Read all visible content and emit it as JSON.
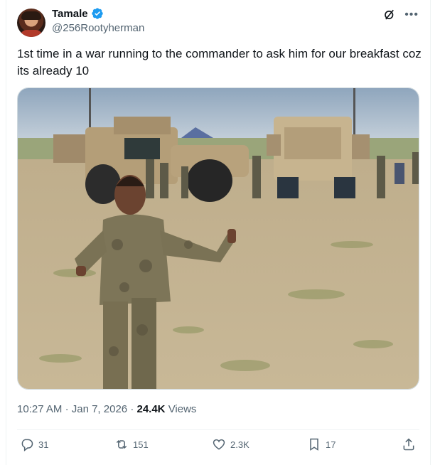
{
  "author": {
    "name": "Tamale",
    "handle": "@256Rootyherman",
    "verified_color": "#1d9bf0"
  },
  "tweet": {
    "text": "1st time in a war running to the commander to ask him for our breakfast coz its already 10"
  },
  "meta": {
    "time": "10:27 AM",
    "sep1": "·",
    "date": "Jan 7, 2026",
    "sep2": "·",
    "views_count": "24.4K",
    "views_label": "Views"
  },
  "actions": {
    "replies": "31",
    "reposts": "151",
    "likes": "2.3K",
    "bookmarks": "17"
  },
  "icons": {
    "reply": "reply-icon",
    "repost": "repost-icon",
    "like": "heart-icon",
    "bookmark": "bookmark-icon",
    "share": "share-icon",
    "grok": "grok-icon",
    "more": "more-icon"
  },
  "colors": {
    "text": "#0f1419",
    "secondary": "#536471",
    "border": "#cfd9de"
  }
}
